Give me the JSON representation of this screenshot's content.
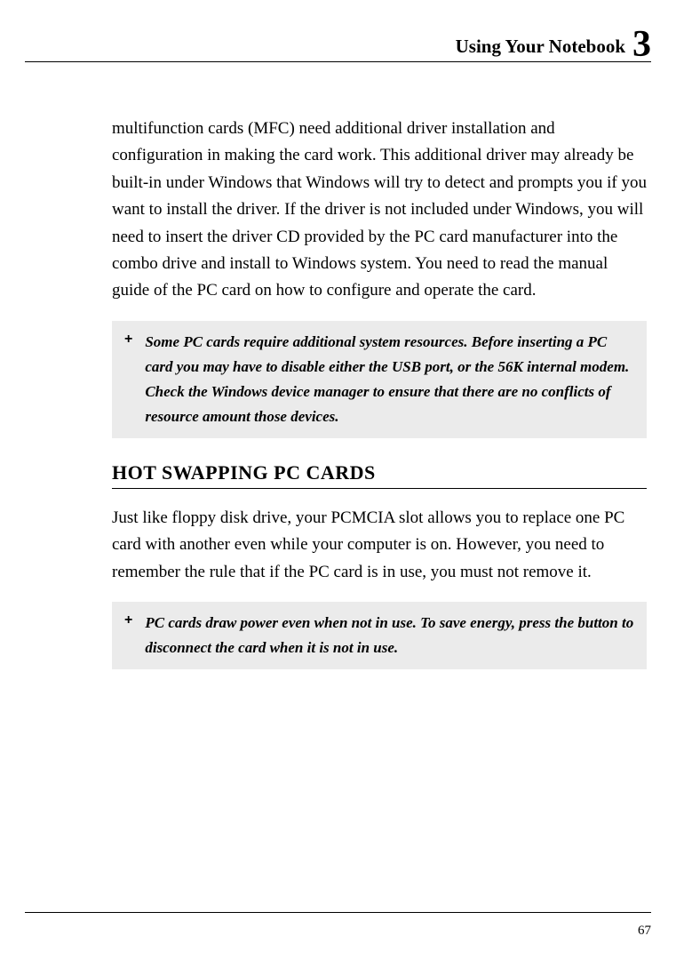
{
  "header": {
    "title": "Using Your Notebook",
    "chapter": "3"
  },
  "paragraphs": {
    "p1": "multifunction cards (MFC) need additional driver installation and configuration in making the card work. This additional driver may already be built-in under Windows that Windows will try to detect and prompts you if you want to install the driver. If the driver is not included under Windows, you will need to insert the driver CD provided by the PC card manufacturer into the combo drive and install to Windows system. You need to read the manual guide of the PC card on how to configure and operate the card."
  },
  "notes": {
    "n1_marker": "+",
    "n1_text": "Some PC cards require additional system resources. Before inserting a PC card you may have to disable either the USB port, or the 56K internal modem. Check the Windows device manager to ensure that there are no conflicts of resource amount those devices.",
    "n2_marker": "+",
    "n2_text": "PC cards draw power even when not in use. To save energy, press the button to disconnect the card when it is not in use."
  },
  "section": {
    "heading": "HOT SWAPPING PC CARDS",
    "body": "Just like floppy disk drive, your PCMCIA slot allows you to replace one PC card with another even while your computer is on. However, you need to remember the rule that if the PC card is in use, you must not remove it."
  },
  "footer": {
    "page_number": "67"
  }
}
